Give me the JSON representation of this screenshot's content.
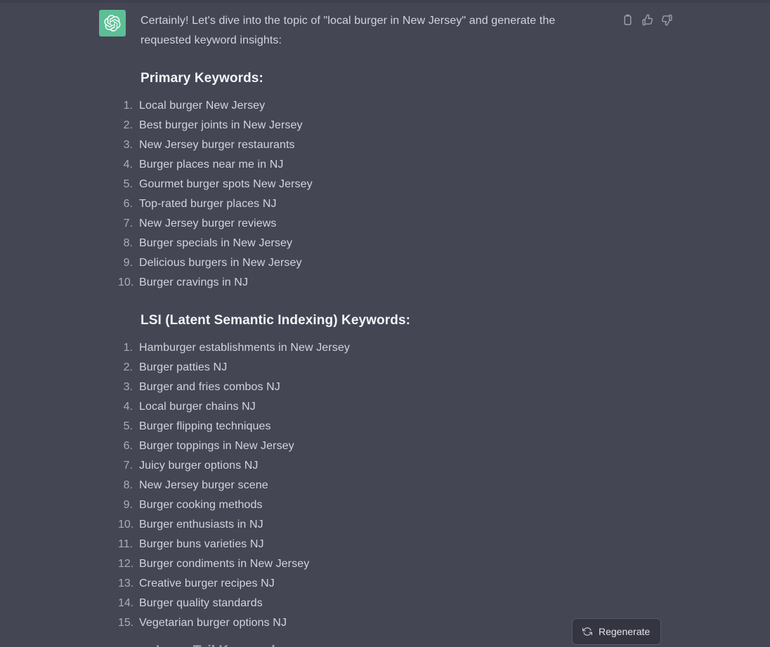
{
  "message": {
    "avatar_icon": "openai-logo-icon",
    "avatar_color": "#5cbf96",
    "intro_paragraph": "Certainly! Let's dive into the topic of \"local burger in New Jersey\" and generate the requested keyword insights:",
    "sections": [
      {
        "heading": "Primary Keywords:",
        "items": [
          "Local burger New Jersey",
          "Best burger joints in New Jersey",
          "New Jersey burger restaurants",
          "Burger places near me in NJ",
          "Gourmet burger spots New Jersey",
          "Top-rated burger places NJ",
          "New Jersey burger reviews",
          "Burger specials in New Jersey",
          "Delicious burgers in New Jersey",
          "Burger cravings in NJ"
        ]
      },
      {
        "heading": "LSI (Latent Semantic Indexing) Keywords:",
        "items": [
          "Hamburger establishments in New Jersey",
          "Burger patties NJ",
          "Burger and fries combos NJ",
          "Local burger chains NJ",
          "Burger flipping techniques",
          "Burger toppings in New Jersey",
          "Juicy burger options NJ",
          "New Jersey burger scene",
          "Burger cooking methods",
          "Burger enthusiasts in NJ",
          "Burger buns varieties NJ",
          "Burger condiments in New Jersey",
          "Creative burger recipes NJ",
          "Burger quality standards",
          "Vegetarian burger options NJ"
        ]
      }
    ],
    "clipped_next_heading": "Long-Tail Keywords:"
  },
  "actions": {
    "copy_label": "Copy",
    "thumbs_up_label": "Good response",
    "thumbs_down_label": "Bad response"
  },
  "footer": {
    "regenerate_label": "Regenerate"
  },
  "theme": {
    "background": "#444654",
    "text": "#d1d5db",
    "heading": "#f3f4f6",
    "muted": "#a9adbb",
    "accent_green": "#5cbf96",
    "button_bg": "#343541",
    "button_border": "#565869"
  }
}
